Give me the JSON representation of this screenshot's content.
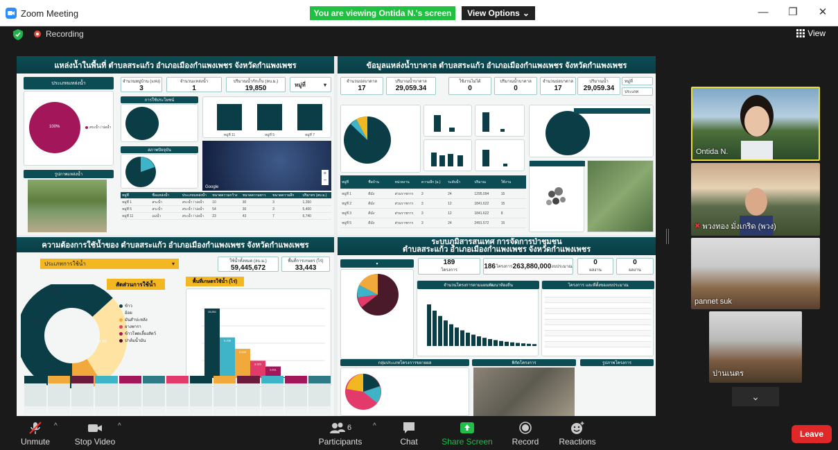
{
  "window": {
    "app_title": "Zoom Meeting",
    "banner": "You are viewing Ontida N.'s screen",
    "view_options": "View Options"
  },
  "topbar": {
    "recording": "Recording",
    "view": "View"
  },
  "dashboard": {
    "p1_title": "แหล่งน้ำในพื้นที่ ตำบลสระแก้ว อำเภอเมืองกำแพงเพชร จังหวัดกำแพงเพชร",
    "p1_tab": "ประเภทแหล่งน้ำ",
    "p1_kpis": [
      {
        "label": "จำนวนหมู่บ้าน (แห่ง)",
        "value": "3"
      },
      {
        "label": "จำนวนแหล่งน้ำ",
        "value": "1"
      },
      {
        "label": "ปริมาณน้ำกักเก็บ (ลบ.ม.)",
        "value": "19,850"
      }
    ],
    "p1_select": "หมู่ที่",
    "pie_big_label": "100%",
    "p1_legend": "สระน้ำ / บ่อน้ำ",
    "sub_usage": "การใช้ประโยชน์",
    "sub_status": "สภาพปัจจุบัน",
    "photo_label": "รูปภาพแหล่งน้ำ",
    "map_brand": "Google",
    "p1_bars": [
      {
        "label": "หมู่ที่ 11",
        "value": 1
      },
      {
        "label": "หมู่ที่ 5",
        "value": 1
      },
      {
        "label": "หมู่ที่ 7",
        "value": 1
      }
    ],
    "p2_title": "ข้อมูลแหล่งน้ำบาดาล ตำบลสระแก้ว อำเภอเมืองกำแพงเพชร จังหวัดกำแพงเพชร",
    "p2_kpis": [
      {
        "label": "จำนวนบ่อบาดาล",
        "value": "17"
      },
      {
        "label": "ปริมาณน้ำบาดาล",
        "value": "29,059.34"
      },
      {
        "label": "ใช้งานไม่ได้",
        "value": "0"
      },
      {
        "label": "ปริมาณน้ำบาดาล",
        "value": "0"
      },
      {
        "label": "จำนวนบ่อบาดาล",
        "value": "17"
      },
      {
        "label": "ปริมาณน้ำ",
        "value": "29,059.34"
      }
    ],
    "p2_sel1": "หมู่ที่",
    "p2_sel2": "ประเภท",
    "p3_title": "ความต้องการใช้น้ำของ ตำบลสระแก้ว อำเภอเมืองกำแพงเพชร จังหวัดกำแพงเพชร",
    "p3_select": "ประเภทการใช้น้ำ",
    "p3_kpis": [
      {
        "label": "ใช้น้ำทั้งหมด (ลบ.ม.)",
        "value": "59,445,672"
      },
      {
        "label": "พื้นที่การเกษตร (ไร่)",
        "value": "33,443"
      }
    ],
    "p3_ratio_label": "สัดส่วนการใช้น้ำ",
    "p3_area_label": "พื้นที่เกษตรใช้น้ำ (ไร่)",
    "donut_labels": [
      "27.9%",
      "8.7%",
      "63.1%"
    ],
    "p3_legend": [
      "ข้าว",
      "อ้อย",
      "มันสำปะหลัง",
      "ยางพารา",
      "ข้าวโพดเลี้ยงสัตว์",
      "ปาล์มน้ำมัน"
    ],
    "p3_bar_labels": [
      "15,851",
      "9,258",
      "6,648",
      "3,923",
      "2,611",
      "138"
    ],
    "p4_title": "ระบบภูมิสารสนเทศ การจัดการป่าชุมชน",
    "p4_subtitle": "ตำบลสระแก้ว อำเภอเมืองกำแพงเพชร จังหวัดกำแพงเพชร",
    "p4_kpis": [
      {
        "label": "โครงการ",
        "value": "189"
      },
      {
        "label": "โครงการ",
        "value": "186"
      },
      {
        "label": "งบประมาณ",
        "value": "263,880,000"
      },
      {
        "label": "ผลงาน",
        "value": "0"
      },
      {
        "label": "ผลงาน",
        "value": "0"
      }
    ],
    "p4_chart_title": "จำนวนโครงการตามแผนพัฒนาท้องถิ่น",
    "p4_table_title": "โครงการ และที่ตั้งของงบประมาณ",
    "p4_group_title": "กลุ่มประเภทโครงการขยายผล",
    "p4_map_title": "พิกัดโครงการ",
    "p4_photo_title": "รูปภาพโครงการ"
  },
  "participants": [
    {
      "name": "Ontida N."
    },
    {
      "name": "พวงทอง มั่งเกริด (พวง)"
    },
    {
      "name": "pannet suk"
    },
    {
      "name": "ปานเนตร"
    }
  ],
  "toolbar": {
    "unmute": "Unmute",
    "stop_video": "Stop Video",
    "participants": "Participants",
    "participants_count": "6",
    "chat": "Chat",
    "share": "Share Screen",
    "record": "Record",
    "reactions": "Reactions",
    "leave": "Leave"
  },
  "colors": {
    "accent_green": "#20c040",
    "teal": "#0c4d55",
    "share_green": "#1fbf4a",
    "leave_red": "#e02828"
  }
}
